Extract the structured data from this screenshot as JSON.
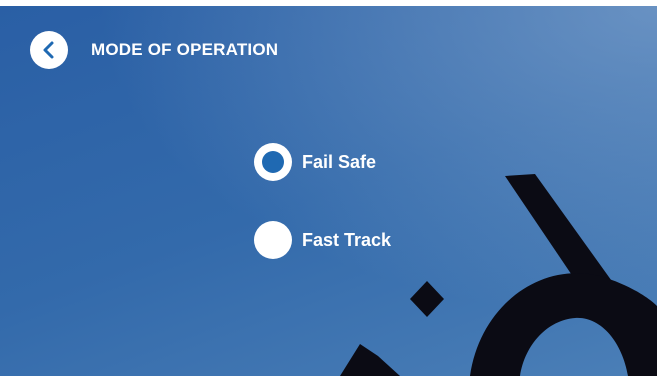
{
  "header": {
    "title": "MODE OF OPERATION",
    "back_icon": "chevron-left-icon"
  },
  "options": [
    {
      "label": "Fail Safe",
      "selected": true
    },
    {
      "label": "Fast Track",
      "selected": false
    }
  ],
  "colors": {
    "background_top": "#2a5fa5",
    "background_light": "#6f97c2",
    "accent": "#1f69b2",
    "text": "#ffffff",
    "watermark": "#0b0b14"
  }
}
